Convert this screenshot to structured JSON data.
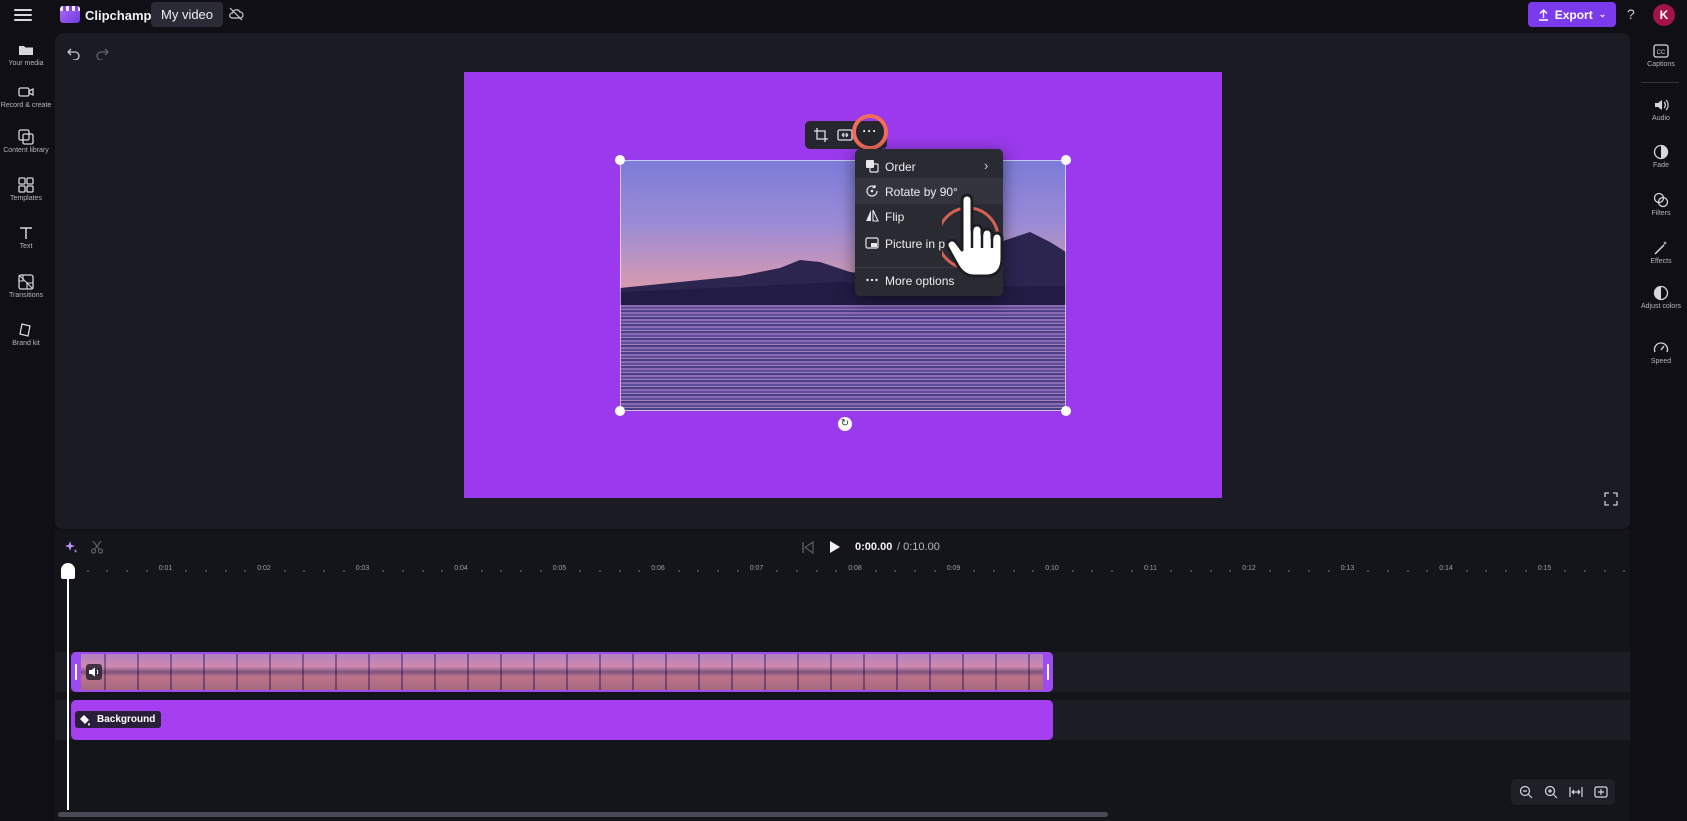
{
  "topbar": {
    "app_name": "Clipchamp",
    "project_tab": "My video",
    "export_label": "Export",
    "help": "?",
    "avatar_initial": "K"
  },
  "left_sidebar": {
    "items": [
      {
        "label": "Your media",
        "icon": "folder-icon"
      },
      {
        "label": "Record & create",
        "icon": "video-camera-icon"
      },
      {
        "label": "Content library",
        "icon": "content-library-icon"
      },
      {
        "label": "Templates",
        "icon": "templates-icon"
      },
      {
        "label": "Text",
        "icon": "text-icon"
      },
      {
        "label": "Transitions",
        "icon": "transitions-icon"
      },
      {
        "label": "Brand kit",
        "icon": "brand-kit-icon"
      }
    ]
  },
  "right_sidebar": {
    "items": [
      {
        "label": "Captions",
        "icon": "captions-icon"
      },
      {
        "label": "Audio",
        "icon": "speaker-icon"
      },
      {
        "label": "Fade",
        "icon": "fade-icon"
      },
      {
        "label": "Filters",
        "icon": "filters-icon"
      },
      {
        "label": "Effects",
        "icon": "magic-wand-icon"
      },
      {
        "label": "Adjust colors",
        "icon": "adjust-colors-icon"
      },
      {
        "label": "Speed",
        "icon": "speedometer-icon"
      }
    ]
  },
  "context_menu": {
    "items": [
      {
        "label": "Order",
        "icon": "layers-icon",
        "has_submenu": true
      },
      {
        "label": "Rotate by 90°",
        "icon": "rotate-icon"
      },
      {
        "label": "Flip",
        "icon": "flip-icon"
      },
      {
        "label": "Picture in p",
        "icon": "picture-in-picture-icon"
      },
      {
        "label": "More options",
        "icon": "more-dots-icon"
      }
    ]
  },
  "playback": {
    "current_time": "0:00.00",
    "total_time": "/ 0:10.00"
  },
  "ruler": {
    "labels": [
      "0:01",
      "0:02",
      "0:03",
      "0:04",
      "0:05",
      "0:06",
      "0:07",
      "0:08",
      "0:09",
      "0:10",
      "0:11",
      "0:12",
      "0:13",
      "0:14",
      "0:15"
    ]
  },
  "timeline": {
    "background_clip_label": "Background"
  },
  "colors": {
    "accent": "#7c3aed",
    "canvas_background": "#9a3aec",
    "highlight_ring": "#f36b5a"
  }
}
